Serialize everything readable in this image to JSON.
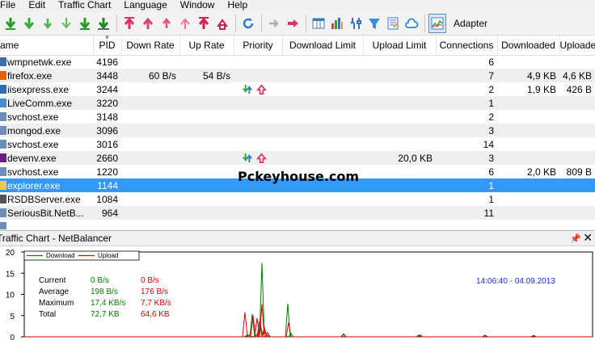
{
  "menu": [
    "File",
    "Edit",
    "Traffic Chart",
    "Language",
    "Window",
    "Help"
  ],
  "toolbar": {
    "adapter_label": "Adapter",
    "icons": [
      "download-priority-high-icon",
      "download-priority-normal-icon",
      "download-priority-low-icon",
      "download-ignore-icon",
      "download-limit-icon",
      "download-block-icon",
      "upload-priority-high-icon",
      "upload-priority-normal-icon",
      "upload-priority-low-icon",
      "upload-ignore-icon",
      "upload-limit-icon",
      "upload-block-icon",
      "refresh-icon",
      "forward-icon",
      "red-arrow-icon",
      "columns-icon",
      "chart-bars-icon",
      "tools-icon",
      "filter-icon",
      "rules-icon",
      "cloud-icon",
      "traffic-chart-icon"
    ]
  },
  "table": {
    "columns": [
      "ame",
      "PID",
      "Down Rate",
      "Up Rate",
      "Priority",
      "Download Limit",
      "Upload Limit",
      "Connections",
      "Downloaded",
      "Uploaded"
    ],
    "rows": [
      {
        "name": "wmpnetwk.exe",
        "pid": "4196",
        "down": "",
        "up": "",
        "prio": "",
        "dlimit": "",
        "ulimit": "",
        "conn": "6",
        "downloaded": "",
        "uploaded": "",
        "icon": "#3a6ea5"
      },
      {
        "name": "firefox.exe",
        "pid": "3448",
        "down": "60 B/s",
        "up": "54 B/s",
        "prio": "",
        "dlimit": "",
        "ulimit": "",
        "conn": "7",
        "downloaded": "4,9 KB",
        "uploaded": "4,6 KB",
        "icon": "#e66000"
      },
      {
        "name": "iisexpress.exe",
        "pid": "3244",
        "down": "",
        "up": "",
        "prio": "icons",
        "dlimit": "",
        "ulimit": "",
        "conn": "2",
        "downloaded": "1,9 KB",
        "uploaded": "426 B",
        "icon": "#2f6fb4"
      },
      {
        "name": "LiveComm.exe",
        "pid": "3220",
        "down": "",
        "up": "",
        "prio": "",
        "dlimit": "",
        "ulimit": "",
        "conn": "1",
        "downloaded": "",
        "uploaded": "",
        "icon": "#4a8ad4"
      },
      {
        "name": "svchost.exe",
        "pid": "3148",
        "down": "",
        "up": "",
        "prio": "",
        "dlimit": "",
        "ulimit": "",
        "conn": "2",
        "downloaded": "",
        "uploaded": "",
        "icon": "#6b8fb8"
      },
      {
        "name": "mongod.exe",
        "pid": "3096",
        "down": "",
        "up": "",
        "prio": "",
        "dlimit": "",
        "ulimit": "",
        "conn": "3",
        "downloaded": "",
        "uploaded": "",
        "icon": "#6b8fb8"
      },
      {
        "name": "svchost.exe",
        "pid": "3016",
        "down": "",
        "up": "",
        "prio": "",
        "dlimit": "",
        "ulimit": "",
        "conn": "14",
        "downloaded": "",
        "uploaded": "",
        "icon": "#6b8fb8"
      },
      {
        "name": "devenv.exe",
        "pid": "2660",
        "down": "",
        "up": "",
        "prio": "icons",
        "dlimit": "",
        "ulimit": "20,0 KB",
        "conn": "3",
        "downloaded": "",
        "uploaded": "",
        "icon": "#68217a"
      },
      {
        "name": "svchost.exe",
        "pid": "1220",
        "down": "",
        "up": "",
        "prio": "",
        "dlimit": "",
        "ulimit": "",
        "conn": "6",
        "downloaded": "2,0 KB",
        "uploaded": "809 B",
        "icon": "#6b8fb8"
      },
      {
        "name": "explorer.exe",
        "pid": "1144",
        "down": "",
        "up": "",
        "prio": "",
        "dlimit": "",
        "ulimit": "",
        "conn": "1",
        "downloaded": "",
        "uploaded": "",
        "icon": "#f2c94c",
        "selected": true
      },
      {
        "name": "RSDBServer.exe",
        "pid": "1084",
        "down": "",
        "up": "",
        "prio": "",
        "dlimit": "",
        "ulimit": "",
        "conn": "1",
        "downloaded": "",
        "uploaded": "",
        "icon": "#555555"
      },
      {
        "name": "SeriousBit.NetB...",
        "pid": "964",
        "down": "",
        "up": "",
        "prio": "",
        "dlimit": "",
        "ulimit": "",
        "conn": "11",
        "downloaded": "",
        "uploaded": "",
        "icon": "#6b8fb8"
      },
      {
        "name": "",
        "pid": "",
        "down": "",
        "up": "",
        "prio": "",
        "dlimit": "",
        "ulimit": "",
        "conn": "",
        "downloaded": "",
        "uploaded": "",
        "icon": "#6b8fb8"
      }
    ]
  },
  "watermark": "Pckeyhouse.com",
  "chart_panel": {
    "title": "Traffic Chart - NetBalancer",
    "timestamp": "14:06:40 - 04.09.2013",
    "legend": [
      "Download",
      "Upload"
    ],
    "stats": [
      {
        "label": "Current",
        "download": "0 B/s",
        "upload": "0 B/s"
      },
      {
        "label": "Average",
        "download": "198 B/s",
        "upload": "176 B/s"
      },
      {
        "label": "Maximum",
        "download": "17,4 KB/s",
        "upload": "7,7 KB/s"
      },
      {
        "label": "Total",
        "download": "72,7 KB",
        "upload": "64,6 KB"
      }
    ]
  },
  "chart_data": {
    "type": "line",
    "ylim": [
      0,
      20
    ],
    "yticks": [
      "20",
      "15",
      "10",
      "5",
      "0"
    ],
    "series": [
      {
        "name": "Download",
        "color": "#008000"
      },
      {
        "name": "Upload",
        "color": "#e00000"
      }
    ]
  }
}
